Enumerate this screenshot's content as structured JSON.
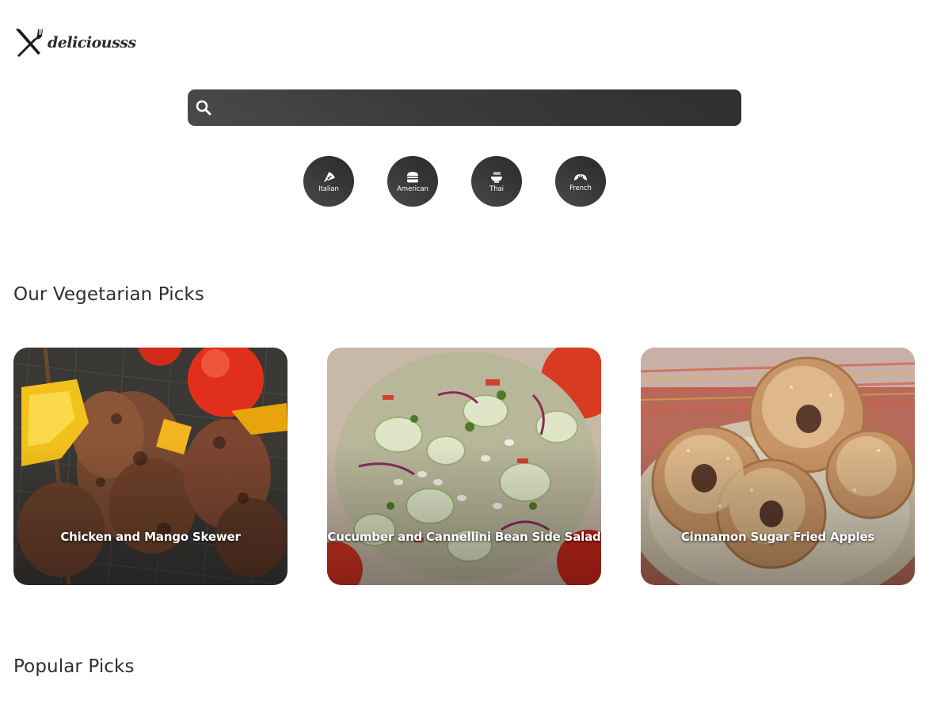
{
  "logo": {
    "text": "deliciousss",
    "icon": "fork-knife-icon"
  },
  "search": {
    "placeholder": "",
    "value": "",
    "icon": "search-icon"
  },
  "categories": [
    {
      "label": "Italian",
      "icon": "pizza-icon"
    },
    {
      "label": "American",
      "icon": "hamburger-icon"
    },
    {
      "label": "Thai",
      "icon": "noodle-bowl-icon"
    },
    {
      "label": "French",
      "icon": "croissant-icon"
    }
  ],
  "sections": {
    "vegetarian": {
      "title": "Our Vegetarian Picks",
      "cards": [
        {
          "title": "Chicken and Mango Skewer",
          "image": "skewer-photo"
        },
        {
          "title": "Cucumber and Cannellini Bean Side Salad",
          "image": "salad-photo"
        },
        {
          "title": "Cinnamon Sugar Fried Apples",
          "image": "fried-apples-photo"
        }
      ]
    },
    "popular": {
      "title": "Popular Picks"
    }
  },
  "colors": {
    "text": "#2f2f2f",
    "control_bg": "#3a3a3a",
    "white": "#ffffff"
  }
}
